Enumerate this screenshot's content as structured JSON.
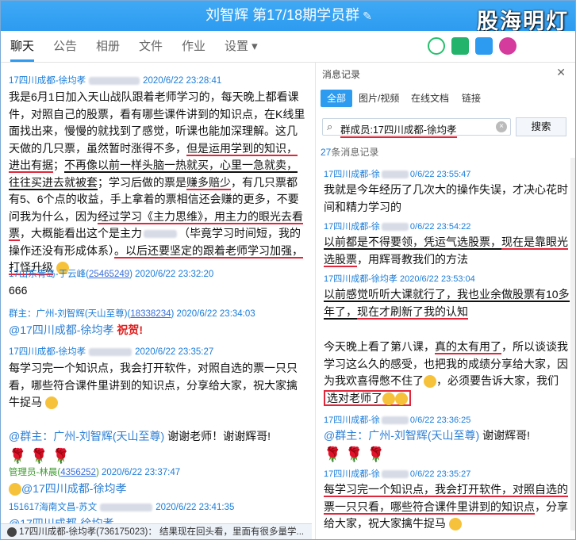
{
  "window": {
    "title": "刘智辉 第17/18期学员群",
    "watermark": "股海明灯"
  },
  "tabs": [
    "聊天",
    "公告",
    "相册",
    "文件",
    "作业",
    "设置 ▾"
  ],
  "left": {
    "m1": {
      "sender": "17四川成都-徐均孝",
      "time": "2020/6/22 23:28:41",
      "t1": "我是6月1日加入天山战队跟着老师学习的，每天晚上都看课件，对照自己的股票，看有哪些课件讲到的知识点，在K线里面找出来，慢慢的就找到了感觉，听课也能加深理解。这几天做的几只票，虽然暂时涨得不多，",
      "u1": "但是运用学到的知识，进出有据",
      "t2": "；",
      "u2": "不再像以前一样头脑一热就买，心里一急就卖，往往买进去就被套",
      "t3": "；学习后做的票是",
      "u3": "赚多赔少",
      "t4": "，有几只票都有5、6个点的收益，手上拿着的票相信还会赚的更多，不要问我为什么，因为",
      "u4": "经过学习《主力思维》，用主力的眼光去看票",
      "t5": "，大概能看出这个是主力",
      "t6": "（毕竟学习时间短，我的操作还没有形成体系）",
      "u5": "。以后还要坚定的跟着老师学习加强，打怪升级"
    },
    "m2": {
      "sender": "17山东青岛-于云峰",
      "qq": "25465249",
      "time": "2020/6/22 23:32:20",
      "text": "666"
    },
    "m3": {
      "sender": "群主：广州-刘智辉(天山至尊)",
      "qq": "18338234",
      "time": "2020/6/22 23:34:03",
      "mention": "@17四川成都-徐均孝",
      "text": "祝贺!"
    },
    "m4": {
      "sender": "17四川成都-徐均孝",
      "time": "2020/6/22 23:35:27",
      "text": "每学习完一个知识点，我会打开软件，对照自选的票一只只看，哪些符合课件里讲到的知识点，分享给大家，祝大家擒牛捉马"
    },
    "m5": {
      "mention": "@群主：广州-刘智辉(天山至尊)",
      "text": "谢谢老师！谢谢辉哥!"
    },
    "m6": {
      "sender": "管理员-林晨",
      "qq": "4356252",
      "time": "2020/6/22 23:37:47",
      "mention": "@17四川成都-徐均孝"
    },
    "m7": {
      "sender": "151617海南文昌-苏文",
      "time": "2020/6/22 23:41:35",
      "mention": "@17四川成都-徐均孝"
    },
    "input": "17四川成都-徐均孝(736175023)： 结果现在回头看，里面有很多量学..."
  },
  "right": {
    "title": "消息记录",
    "filters": [
      "全部",
      "图片/视频",
      "在线文档",
      "链接"
    ],
    "search_value": "群成员:17四川成都-徐均孝",
    "search_button": "搜索",
    "count_num": "27",
    "count_text": "条消息记录",
    "r1": {
      "sender": "17四川成都-徐",
      "time": "0/6/22 23:55:47",
      "text": "我就是今年经历了几次大的操作失误，才决心花时间和精力学习的"
    },
    "r2": {
      "sender": "17四川成都-徐",
      "time": "0/6/22 23:54:22",
      "t1": "以前都是不得要领，凭运气选股票，",
      "u1": "现在是靠眼光选股票",
      "t2": "，用辉哥教我们的方法"
    },
    "r3": {
      "sender": "17四川成都-徐均孝",
      "time": "2020/6/22 23:53:04",
      "t1": "以前感觉听听大课就行了，我也业余做股票有10多年了，",
      "u1": "现在才刷新了我的认知"
    },
    "r4": {
      "t1": "今天晚上看了第八课，",
      "u1": "真的太有用了",
      "t2": "，所以谈谈我学习这么久的感受，也把我的成绩分享给大家，因为我欢喜得憋不住了",
      "t3": "，必须要告诉大家，我们",
      "box": "选对老师了"
    },
    "r5": {
      "sender": "17四川成都-徐",
      "time": "0/6/22 23:36:25",
      "mention": "@群主：广州-刘智辉(天山至尊)",
      "text": "谢谢辉哥!"
    },
    "r6": {
      "sender": "17四川成都-徐",
      "time": "0/6/22 23:35:27",
      "u1": "每学习完一个知识点，我会打开软件，对照自选的票一只只看，哪些符合课件里讲到的知识点",
      "t1": "，分享给大家，祝大家擒牛捉马"
    }
  }
}
